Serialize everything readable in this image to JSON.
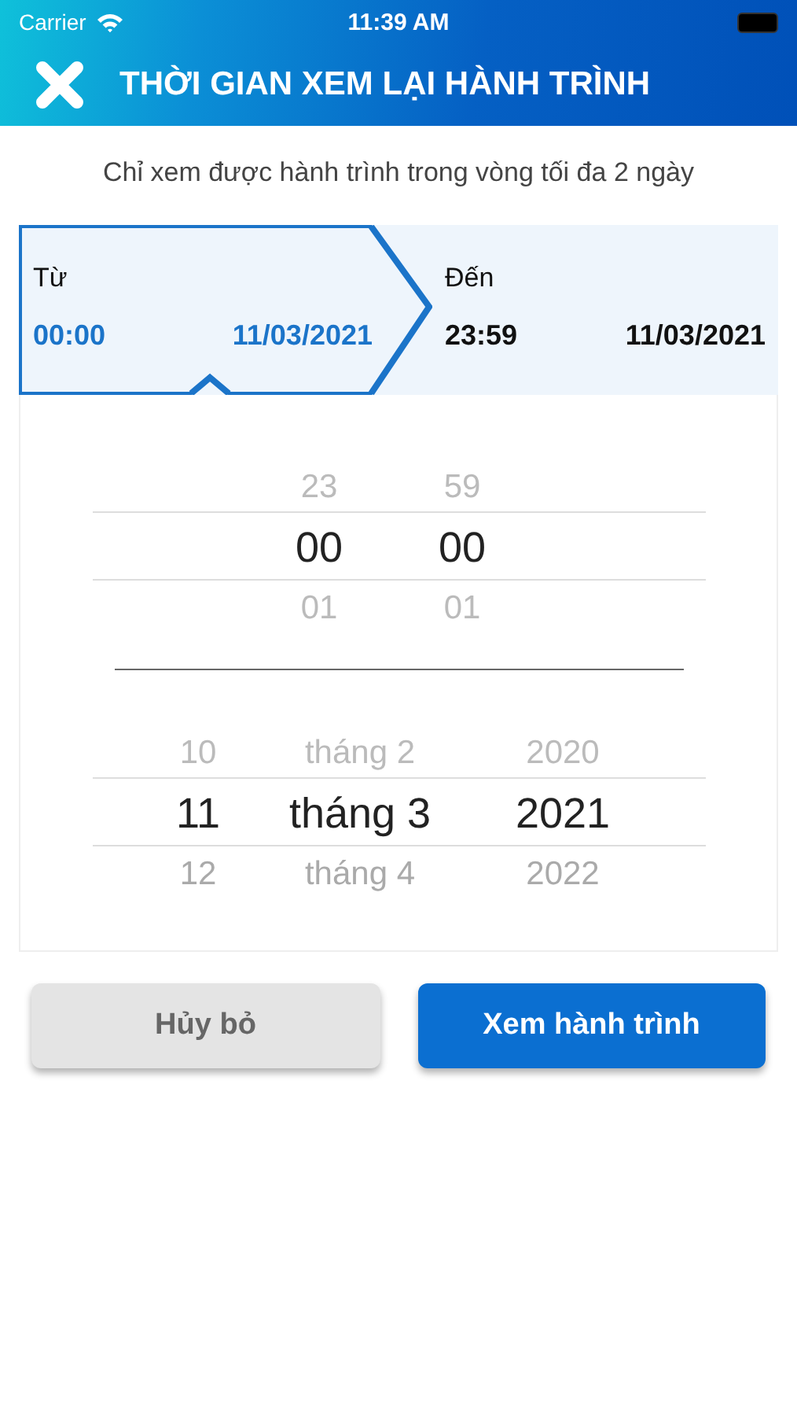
{
  "status_bar": {
    "carrier": "Carrier",
    "time": "11:39 AM"
  },
  "header": {
    "title": "THỜI GIAN XEM LẠI HÀNH TRÌNH"
  },
  "notice": "Chỉ xem được hành trình trong vòng tối đa 2 ngày",
  "range_tabs": [
    {
      "label": "Từ",
      "time": "00:00",
      "date": "11/03/2021",
      "selected": true
    },
    {
      "label": "Đến",
      "time": "23:59",
      "date": "11/03/2021",
      "selected": false
    }
  ],
  "pickers": [
    {
      "kind": "time",
      "columns": [
        {
          "items": [
            {
              "text": "23",
              "selected": false
            },
            {
              "text": "00",
              "selected": true
            },
            {
              "text": "01",
              "selected": false
            }
          ]
        },
        {
          "items": [
            {
              "text": "59",
              "selected": false
            },
            {
              "text": "00",
              "selected": true
            },
            {
              "text": "01",
              "selected": false
            }
          ]
        }
      ]
    },
    {
      "kind": "date",
      "columns": [
        {
          "items": [
            {
              "text": "10",
              "selected": false
            },
            {
              "text": "11",
              "selected": true
            },
            {
              "text": "12",
              "selected": false
            }
          ]
        },
        {
          "items": [
            {
              "text": "tháng 2",
              "selected": false
            },
            {
              "text": "tháng 3",
              "selected": true
            },
            {
              "text": "tháng 4",
              "selected": false
            }
          ]
        },
        {
          "items": [
            {
              "text": "2020",
              "selected": false
            },
            {
              "text": "2021",
              "selected": true
            },
            {
              "text": "2022",
              "selected": false
            }
          ]
        }
      ]
    }
  ],
  "buttons": [
    {
      "kind": "secondary",
      "label": "Hủy bỏ"
    },
    {
      "kind": "primary",
      "label": "Xem hành trình"
    }
  ]
}
